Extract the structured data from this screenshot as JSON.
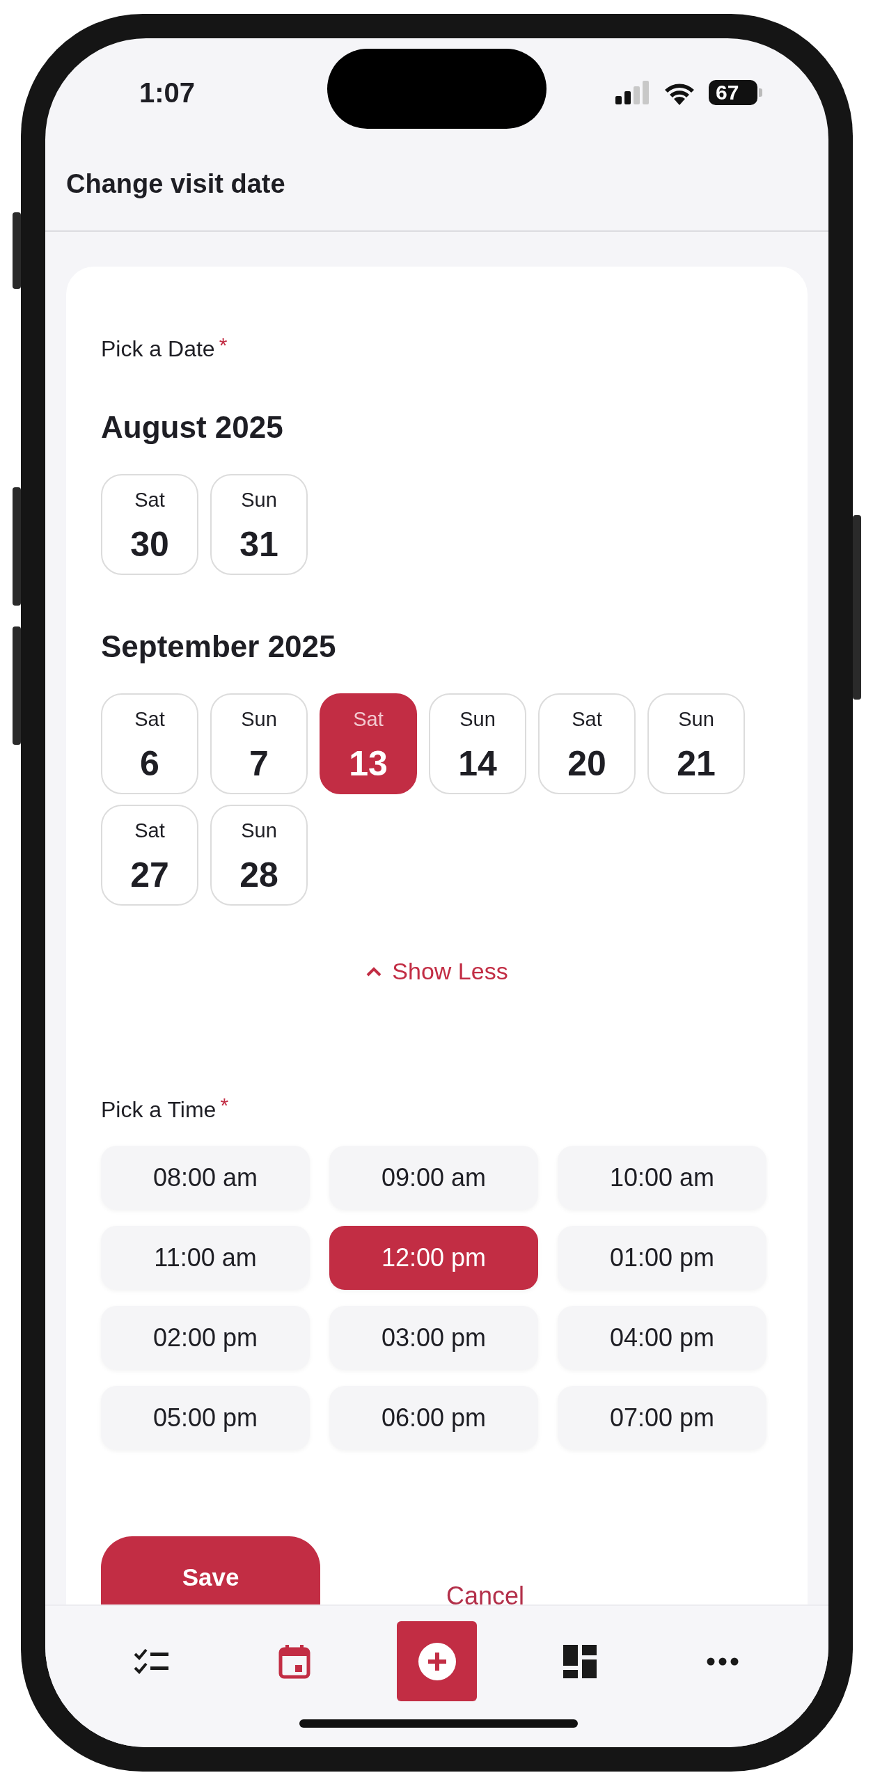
{
  "status_bar": {
    "time": "1:07",
    "battery": "67"
  },
  "header": {
    "title": "Change visit date"
  },
  "date_picker": {
    "label": "Pick a Date",
    "required_mark": "*",
    "months": [
      {
        "title": "August 2025",
        "days": [
          {
            "weekday": "Sat",
            "day": "30",
            "selected": false
          },
          {
            "weekday": "Sun",
            "day": "31",
            "selected": false
          }
        ]
      },
      {
        "title": "September 2025",
        "days": [
          {
            "weekday": "Sat",
            "day": "6",
            "selected": false
          },
          {
            "weekday": "Sun",
            "day": "7",
            "selected": false
          },
          {
            "weekday": "Sat",
            "day": "13",
            "selected": true
          },
          {
            "weekday": "Sun",
            "day": "14",
            "selected": false
          },
          {
            "weekday": "Sat",
            "day": "20",
            "selected": false
          },
          {
            "weekday": "Sun",
            "day": "21",
            "selected": false
          },
          {
            "weekday": "Sat",
            "day": "27",
            "selected": false
          },
          {
            "weekday": "Sun",
            "day": "28",
            "selected": false
          }
        ]
      }
    ],
    "toggle": "Show Less"
  },
  "time_picker": {
    "label": "Pick a Time",
    "required_mark": "*",
    "slots": [
      {
        "label": "08:00 am",
        "selected": false
      },
      {
        "label": "09:00 am",
        "selected": false
      },
      {
        "label": "10:00 am",
        "selected": false
      },
      {
        "label": "11:00 am",
        "selected": false
      },
      {
        "label": "12:00 pm",
        "selected": true
      },
      {
        "label": "01:00 pm",
        "selected": false
      },
      {
        "label": "02:00 pm",
        "selected": false
      },
      {
        "label": "03:00 pm",
        "selected": false
      },
      {
        "label": "04:00 pm",
        "selected": false
      },
      {
        "label": "05:00 pm",
        "selected": false
      },
      {
        "label": "06:00 pm",
        "selected": false
      },
      {
        "label": "07:00 pm",
        "selected": false
      }
    ]
  },
  "actions": {
    "save": "Save",
    "cancel": "Cancel"
  },
  "bottom_nav": [
    {
      "kind": "tasks",
      "selected": false
    },
    {
      "kind": "calendar",
      "selected": true
    },
    {
      "kind": "add",
      "selected": false
    },
    {
      "kind": "dashboard",
      "selected": false
    },
    {
      "kind": "more",
      "selected": false
    }
  ]
}
